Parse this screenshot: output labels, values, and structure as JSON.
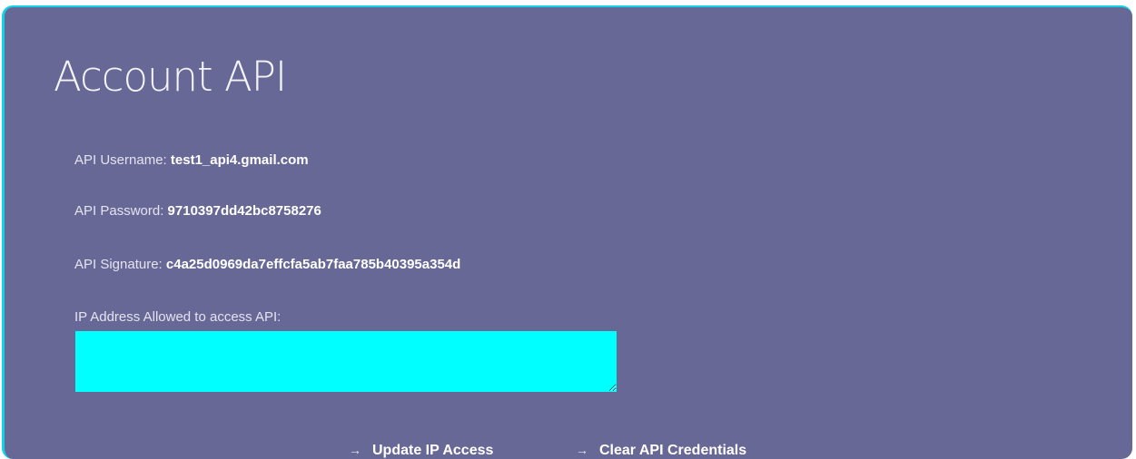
{
  "page": {
    "title": "Account API"
  },
  "credentials": {
    "username_label": "API Username:",
    "username_value": "test1_api4.gmail.com",
    "password_label": "API Password:",
    "password_value": "9710397dd42bc8758276",
    "signature_label": "API Signature:",
    "signature_value": "c4a25d0969da7effcfa5ab7faa785b40395a354d"
  },
  "ip_access": {
    "label": "IP Address Allowed to access API:",
    "value": ""
  },
  "actions": {
    "update_label": "Update IP Access",
    "clear_label": "Clear API Credentials",
    "arrow_glyph": "→"
  },
  "colors": {
    "panel_background": "#686896",
    "panel_border": "#12d2e8",
    "input_background": "#00ffff",
    "text": "#ffffff"
  }
}
